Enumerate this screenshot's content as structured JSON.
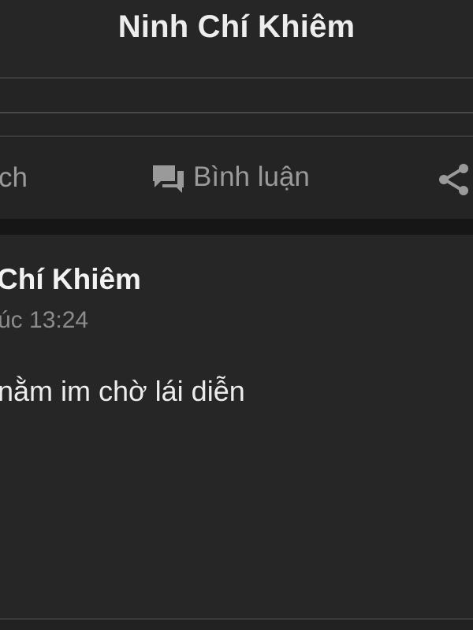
{
  "header": {
    "title": "Ninh Chí Khiêm"
  },
  "actions": {
    "left_partial_label": "ch",
    "comment_label": "Bình luận",
    "comment_icon": "comment-icon",
    "share_icon": "share-icon"
  },
  "post": {
    "author": "Chí Khiêm",
    "timestamp": "úc 13:24",
    "content": "nằm im chờ lái diễn"
  },
  "colors": {
    "background": "#242424",
    "header_bg": "#262626",
    "divider": "#161616",
    "text_primary": "#f2f2f2",
    "text_secondary": "#9a9a9a"
  }
}
